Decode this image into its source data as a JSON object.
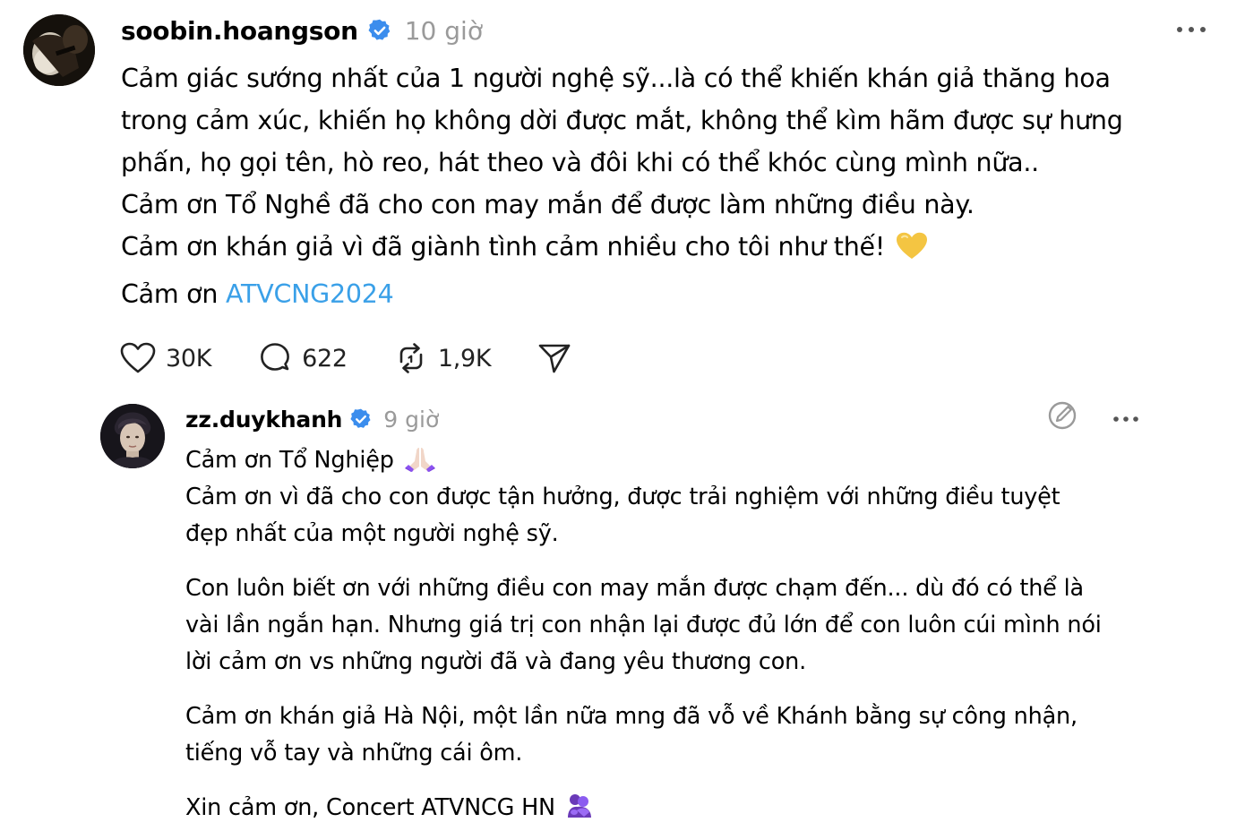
{
  "post": {
    "username": "soobin.hoangson",
    "time": "10 giờ",
    "lines": [
      "Cảm giác sướng nhất của 1 người nghệ sỹ...là có thể khiến khán giả thăng hoa",
      "trong cảm xúc, khiến họ không dời được mắt, không thể kìm hãm được sự hưng",
      "phấn, họ gọi tên, hò reo, hát theo và đôi khi có thể khóc cùng mình nữa..",
      "Cảm ơn Tổ Nghề đã cho con may mắn để được làm những điều này.",
      "Cảm ơn khán giả vì đã giành tình cảm nhiều cho tôi như thế!"
    ],
    "last_line_prefix": "Cảm ơn ",
    "hashtag": "ATVCNG2024",
    "likes": "30K",
    "comments": "622",
    "reposts": "1,9K",
    "icons": {
      "heart_emoji": "yellow-heart",
      "like": "heart-icon",
      "comment": "comment-icon",
      "repost": "repost-icon",
      "share": "send-icon",
      "more": "more-icon",
      "verified": "verified-badge-icon"
    }
  },
  "reply": {
    "username": "zz.duykhanh",
    "time": "9 giờ",
    "paragraphs": [
      [
        "Cảm ơn Tổ Nghiệp"
      ],
      [
        "Cảm ơn vì đã cho con được tận hưởng, được trải nghiệm với những điều tuyệt",
        "đẹp nhất của một người nghệ sỹ."
      ],
      [
        "Con luôn biết ơn với những điều con may mắn được chạm đến... dù đó có thể là",
        "vài lần ngắn hạn. Nhưng giá trị con nhận lại được đủ lớn để con luôn cúi mình nói",
        "lời cảm ơn vs những người đã và đang yêu thương con."
      ],
      [
        "Cảm ơn khán giả Hà Nội, một lần nữa mng đã vỗ về Khánh bằng sự công nhận,",
        "tiếng vỗ tay và những cái ôm."
      ],
      [
        "Xin cảm ơn, Concert ATVNCG HN"
      ]
    ],
    "icons": {
      "first_line_emoji": "folded-hands",
      "last_line_emoji": "people-hugging",
      "edit": "edit-icon",
      "more": "more-icon"
    }
  },
  "colors": {
    "hashtag": "#3aa0e8",
    "verified": "#3b8ded",
    "muted_text": "#9a9a9a",
    "heart_emoji": "#f4c542"
  }
}
